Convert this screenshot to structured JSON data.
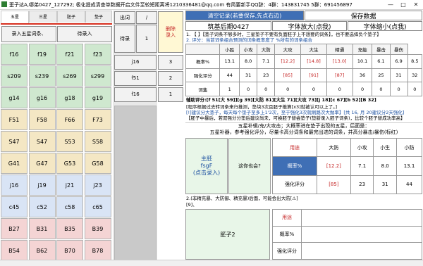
{
  "window": {
    "title": "歪子达A,哪弟0427_127292; 极化提成清查单数据开启文件至较短距离将1210336481@qq.com  有简要新手QQ辞：4群：143831745  5群：691456897",
    "minimize": "—",
    "maximize": "□",
    "close": "✕"
  },
  "tabs": [
    {
      "label": "五星"
    },
    {
      "label": "三星"
    },
    {
      "label": "胚子"
    },
    {
      "label": "垫子"
    }
  ],
  "left": {
    "enter5_label": "录入五星词条、",
    "pending_label": "待录入",
    "grid": [
      [
        "f16",
        "f19",
        "f21",
        "f23"
      ],
      [
        "s209",
        "s239",
        "s269",
        "s299"
      ],
      [
        "g14",
        "g16",
        "g18",
        "g19"
      ],
      [
        "F51",
        "F58",
        "F66",
        "F73"
      ],
      [
        "S47",
        "S47",
        "S53",
        "S58"
      ],
      [
        "G41",
        "G47",
        "G53",
        "G58"
      ],
      [
        "j16",
        "j19",
        "j21",
        "j23"
      ],
      [
        "c45",
        "c52",
        "c58",
        "c65"
      ],
      [
        "B27",
        "B31",
        "B35",
        "B39"
      ],
      [
        "B54",
        "B62",
        "B70",
        "B78"
      ]
    ],
    "cell_colors": [
      "#cfe8cf",
      "#cfe8cf",
      "#cfe8cf",
      "#f4e7c4",
      "#f4e7c4",
      "#f4e7c4",
      "#d9e4f5",
      "#d9e4f5",
      "#f4d4d4",
      "#f4d4d4"
    ]
  },
  "mid": {
    "out_label": "出词",
    "slash_label": "/",
    "delete_label": "删除\n录入",
    "pending_label": "待录",
    "pending_count": "1",
    "rows": [
      {
        "k": "j16",
        "v": "3"
      },
      {
        "k": "f51",
        "v": "2"
      },
      {
        "k": "f16",
        "v": "1"
      }
    ]
  },
  "right": {
    "clear": "清空记录(若要保存,先点右边)",
    "save": "保存数据",
    "phase": "筑基后期0427",
    "font_big": "字体放大(点我)",
    "font_small": "字体缩小(点我)",
    "note1": "1. 【 】【垫子词条不够多时，三星垫子不要有负面胚子上不想要的词条】，也不要选择负个垫子】",
    "note2": "2. 评分：当前词条组合预测的词条概率度了 %所有的词条组合",
    "header": [
      "",
      "小胜",
      "小攻",
      "大防",
      "大攻",
      "大生",
      "精通",
      "充能",
      "暴击",
      "暴伤"
    ],
    "rows": [
      {
        "label": "概率%",
        "cells": [
          "13.1",
          "8.0",
          "7.1",
          "[12.2]",
          "[14.8]",
          "[13.0]",
          "10.1",
          "6.1",
          "6.9",
          "8.5"
        ]
      },
      {
        "label": "强化评分",
        "cells": [
          "44",
          "31",
          "23",
          "[85]",
          "[91]",
          "[87]",
          "36",
          "25",
          "31",
          "32"
        ]
      },
      {
        "label": "词集",
        "cells": [
          "1",
          "0",
          "0",
          "0",
          "0",
          "0",
          "0",
          "0",
          "0",
          "0"
        ]
      }
    ],
    "aux": "辅助评分:[f 51[大 59]][g 39][大防 81][大生 71][大攻 73][j 18][c 67][b 52][B 32]",
    "warn1": "[程序根据过去转词条来行推测，垫块3次且胚子推算[x3]就被认可以上了。]",
    "warn2": "[!]建议分大垫子，每天每个垫子至多上1'2次，至于强化3次就刷路次大抛率】[共 16, 月 20建议分2天强化]",
    "warn3": "【胚子中暴后，若双强分分垫后建议尚未，可换胚子替尝垫子(垫新录入胚子词条)，比较个胚子替成功率高】",
    "five": "五星补辑/充/大攻击；大概率进在垫子出现的五星，后面是：",
    "five2": "五星补器，参考强化评分，尽量卡高分词条和最完出进的词条，并高分暴击/暴伤(标红)",
    "main_label": "主胚\nfsgF\n(点击录入)",
    "spare_label": "这你也会?",
    "cards_header": [
      "用途",
      "大防",
      "小攻",
      "小生",
      "小防"
    ],
    "card_rows": [
      {
        "label": "概率%",
        "cells": [
          "[12.2]",
          "7.1",
          "8.0",
          "13.1"
        ]
      },
      {
        "label": "强化评分",
        "cells": [
          "[85]",
          "23",
          "31",
          "44"
        ]
      }
    ],
    "bottom_note": "2.(非精充暴、大防御、精充暴)后面，可能会出大防[⚠]",
    "p9": "[9]、",
    "second_label": "胚子2",
    "card2_header": [
      "用途"
    ],
    "card2_rows": [
      {
        "label": "概率%"
      },
      {
        "label": "强化评分"
      }
    ]
  },
  "colors": {
    "blue_header": "#3f6fb5",
    "red": "#c62828",
    "green": "#e8f6e8",
    "yellow": "#fff8d4"
  }
}
